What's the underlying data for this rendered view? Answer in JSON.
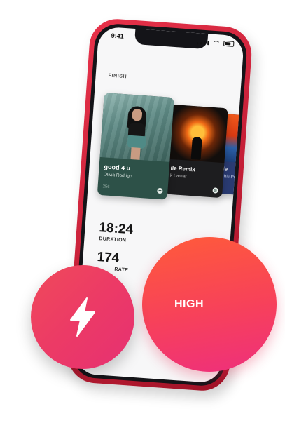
{
  "status_bar": {
    "time": "9:41"
  },
  "screen": {
    "section_label": "FINISH",
    "tracks": [
      {
        "title": "good 4 u",
        "artist": "Olivia Rodrigo",
        "count": "256"
      },
      {
        "title": "ile Remix",
        "artist": "k Lamar"
      },
      {
        "title": "de",
        "artist": "Chili Peppers"
      }
    ],
    "stats": [
      {
        "value": "18:24",
        "label": "DURATION"
      },
      {
        "value": "174",
        "label": "RATE"
      }
    ]
  },
  "intensity_button": {
    "label": "HIGH"
  },
  "boost_button": {
    "icon": "lightning-bolt-icon"
  },
  "colors": {
    "phone_red": "#d7263d",
    "accent_coral": "#f7415a",
    "accent_pink": "#ec3a66",
    "card_green": "#2d5148"
  }
}
